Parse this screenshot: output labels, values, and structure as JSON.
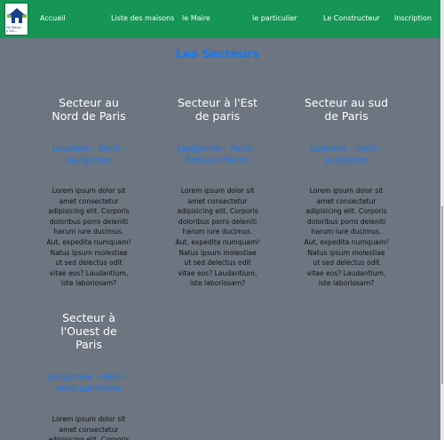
{
  "nav": {
    "logo_text": "Ma Maison\nà 100...",
    "items": [
      "Accueil",
      "Liste des maisons",
      "le Maire",
      "le particulier",
      "Le Constructeur",
      "Inscription"
    ]
  },
  "section_title": "Les Secteurs",
  "sectors": [
    {
      "title": "Secteur au Nord de Paris",
      "towns": "Louviers - Paris - Jaulgonne",
      "text": "Lorem ipsum dolor sit amet consectetur adipisicing elit. Corporis doloribus porro deleniti harum iure ducimus. Aut, expedita numquam! Natus ipsum molestiae ut sed delectus odit vitae eos? Laudantium, iste laboriosam?"
    },
    {
      "title": "Secteur à l'Est de paris",
      "towns": "Jaulgonne - Paris - Pont-sur-Yonne",
      "text": "Lorem ipsum dolor sit amet consectetur adipisicing elit. Corporis doloribus porro deleniti harum iure ducimus. Aut, expedita numquam! Natus ipsum molestiae ut sed delectus odit vitae eos? Laudantium, iste laboriosam?"
    },
    {
      "title": "Secteur au sud de Paris",
      "towns": "Louviers - Paris - Jaulgonne",
      "text": "Lorem ipsum dolor sit amet consectetur adipisicing elit. Corporis doloribus porro deleniti harum iure ducimus. Aut, expedita numquam! Natus ipsum molestiae ut sed delectus odit vitae eos? Laudantium, iste laboriosam?"
    },
    {
      "title": "Secteur à l'Ouest de Paris",
      "towns": "Jaulgonne - Paris - Pont-sur-Yonne",
      "text": "Lorem ipsum dolor sit amet consectetur adipisicing elit. Corporis"
    }
  ],
  "colors": {
    "navbar": "#159654",
    "background": "#6c7580",
    "accent": "#1877f2"
  }
}
